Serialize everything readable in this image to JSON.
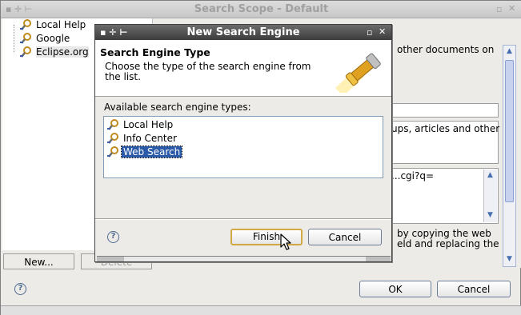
{
  "back_window": {
    "title": "Search Scope - Default",
    "tree_items": [
      "Local Help",
      "Google",
      "Eclipse.org"
    ],
    "text_fragments": {
      "line1": "other documents on",
      "line2": "ups, articles and other",
      "line3": "...cgi?q=",
      "line4": "by copying the web",
      "line5": "eld and replacing the"
    },
    "new_button": "New...",
    "delete_button": "Delete",
    "ok_button": "OK",
    "cancel_button": "Cancel"
  },
  "dialog": {
    "title": "New Search Engine",
    "heading": "Search Engine Type",
    "description": "Choose the type of the search engine from the list.",
    "list_label": "Available search engine types:",
    "types": [
      {
        "label": "Local Help",
        "selected": false
      },
      {
        "label": "Info Center",
        "selected": false
      },
      {
        "label": "Web Search",
        "selected": true
      }
    ],
    "finish_button": "Finish",
    "cancel_button": "Cancel"
  },
  "colors": {
    "selection": "#2a5aa8",
    "dialog_titlebar": "#4a4a4a",
    "default_button_border": "#d1a843"
  },
  "icons": [
    "search-engine-icon",
    "flashlight-icon",
    "help-icon",
    "minimize-icon",
    "close-icon",
    "mouse-cursor-icon"
  ]
}
